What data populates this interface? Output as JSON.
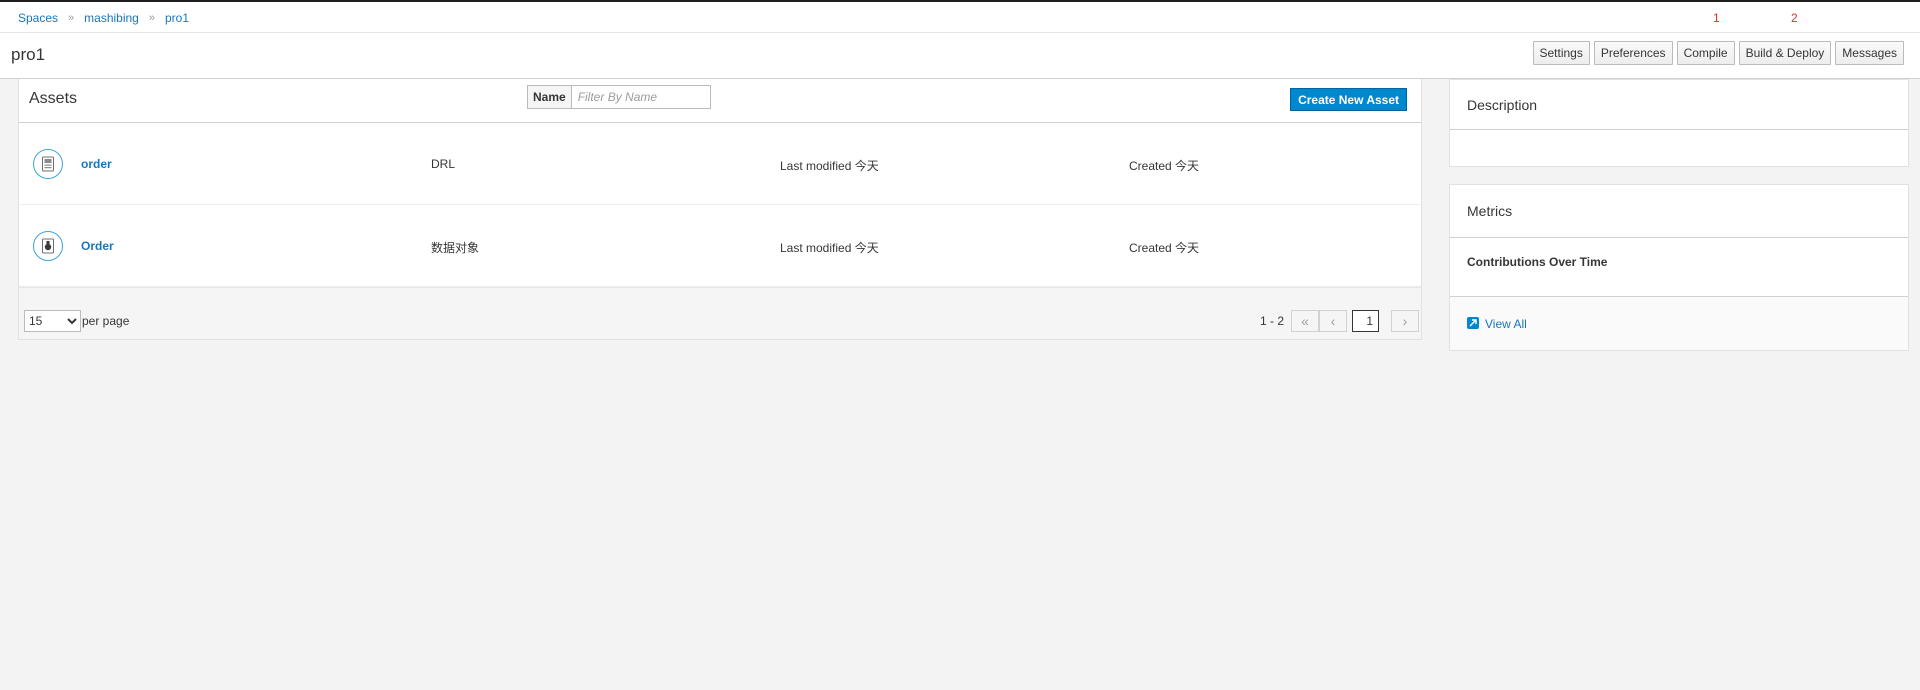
{
  "breadcrumb": {
    "items": [
      "Spaces",
      "mashibing",
      "pro1"
    ],
    "separator": "»"
  },
  "markers": [
    "1",
    "2"
  ],
  "page": {
    "title": "pro1"
  },
  "toolbar": {
    "settings": "Settings",
    "preferences": "Preferences",
    "compile": "Compile",
    "build_deploy": "Build & Deploy",
    "messages": "Messages"
  },
  "assets": {
    "title": "Assets",
    "filter_label": "Name",
    "filter_placeholder": "Filter By Name",
    "create_button": "Create New Asset",
    "rows": [
      {
        "name": "order",
        "type": "DRL",
        "modified": "Last modified 今天",
        "created": "Created 今天",
        "icon": "drl-file-icon"
      },
      {
        "name": "Order",
        "type": "数据对象",
        "modified": "Last modified 今天",
        "created": "Created 今天",
        "icon": "data-object-icon"
      }
    ],
    "pager": {
      "per_page_value": "15",
      "per_page_label": "per page",
      "range": "1 - 2",
      "current_page": "1"
    }
  },
  "description": {
    "title": "Description"
  },
  "metrics": {
    "title": "Metrics",
    "subtitle": "Contributions Over Time",
    "view_all": "View All"
  },
  "colors": {
    "link": "#1b75bb",
    "primary": "#0088ce",
    "marker": "#d9332b",
    "background": "#f3f3f3"
  }
}
